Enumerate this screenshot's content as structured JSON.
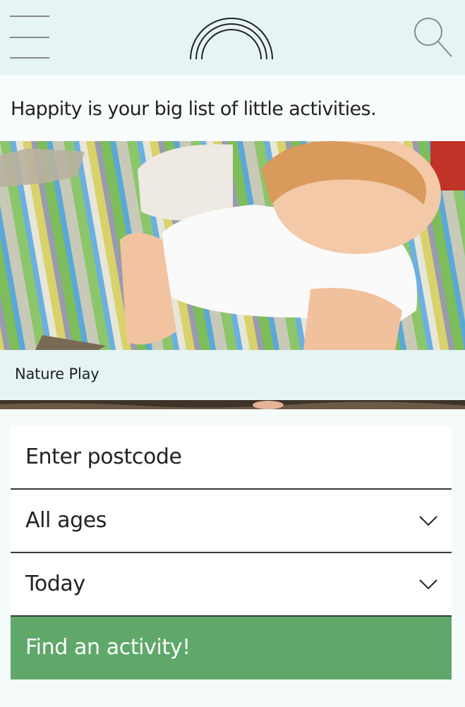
{
  "header": {
    "menu_icon": "hamburger-icon",
    "logo_icon": "rainbow-logo",
    "search_icon": "search-icon"
  },
  "tagline": "Happity is your big list of little activities.",
  "hero": {
    "caption": "Nature Play"
  },
  "form": {
    "postcode_placeholder": "Enter postcode",
    "age_value": "All ages",
    "date_value": "Today",
    "submit_label": "Find an activity!"
  },
  "colors": {
    "header_bg": "#e6f4f4",
    "cta_green": "#5fa86a"
  }
}
